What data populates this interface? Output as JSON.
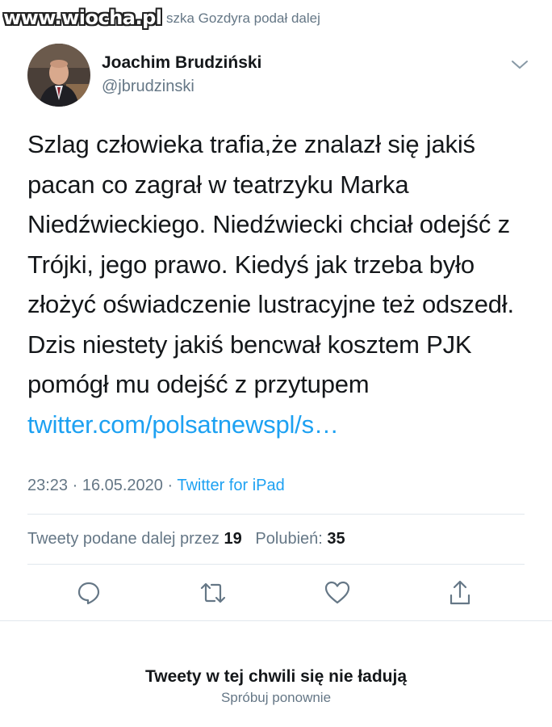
{
  "header": {
    "watermark": "www.wiocha.pl",
    "retweeted_by": "szka Gozdyra podał dalej"
  },
  "author": {
    "name": "Joachim Brudziński",
    "handle": "@jbrudzinski"
  },
  "tweet": {
    "text": "Szlag człowieka trafia,że znalazł się jakiś pacan co zagrał w teatrzyku Marka Niedźwieckiego. Niedźwiecki chciał odejść z Trójki, jego prawo. Kiedyś jak trzeba było złożyć oświadczenie lustracyjne też odszedł. Dzis niestety jakiś bencwał kosztem PJK pomógł mu odejść z przytupem ",
    "link": "twitter.com/polsatnewspl/s…",
    "time": "23:23 · 16.05.2020 · ",
    "source": "Twitter for iPad"
  },
  "stats": {
    "retweets_label": "Tweety podane dalej przez ",
    "retweets_count": "19",
    "likes_label": "Polubień: ",
    "likes_count": "35"
  },
  "actions": {
    "icons": [
      "reply-icon",
      "retweet-icon",
      "like-icon",
      "share-icon"
    ]
  },
  "error": {
    "title": "Tweety w tej chwili się nie ładują",
    "retry": "Spróbuj ponownie"
  },
  "colors": {
    "accent": "#1da1f2",
    "text": "#14171a",
    "muted": "#657786",
    "divider": "#e1e8ed"
  }
}
